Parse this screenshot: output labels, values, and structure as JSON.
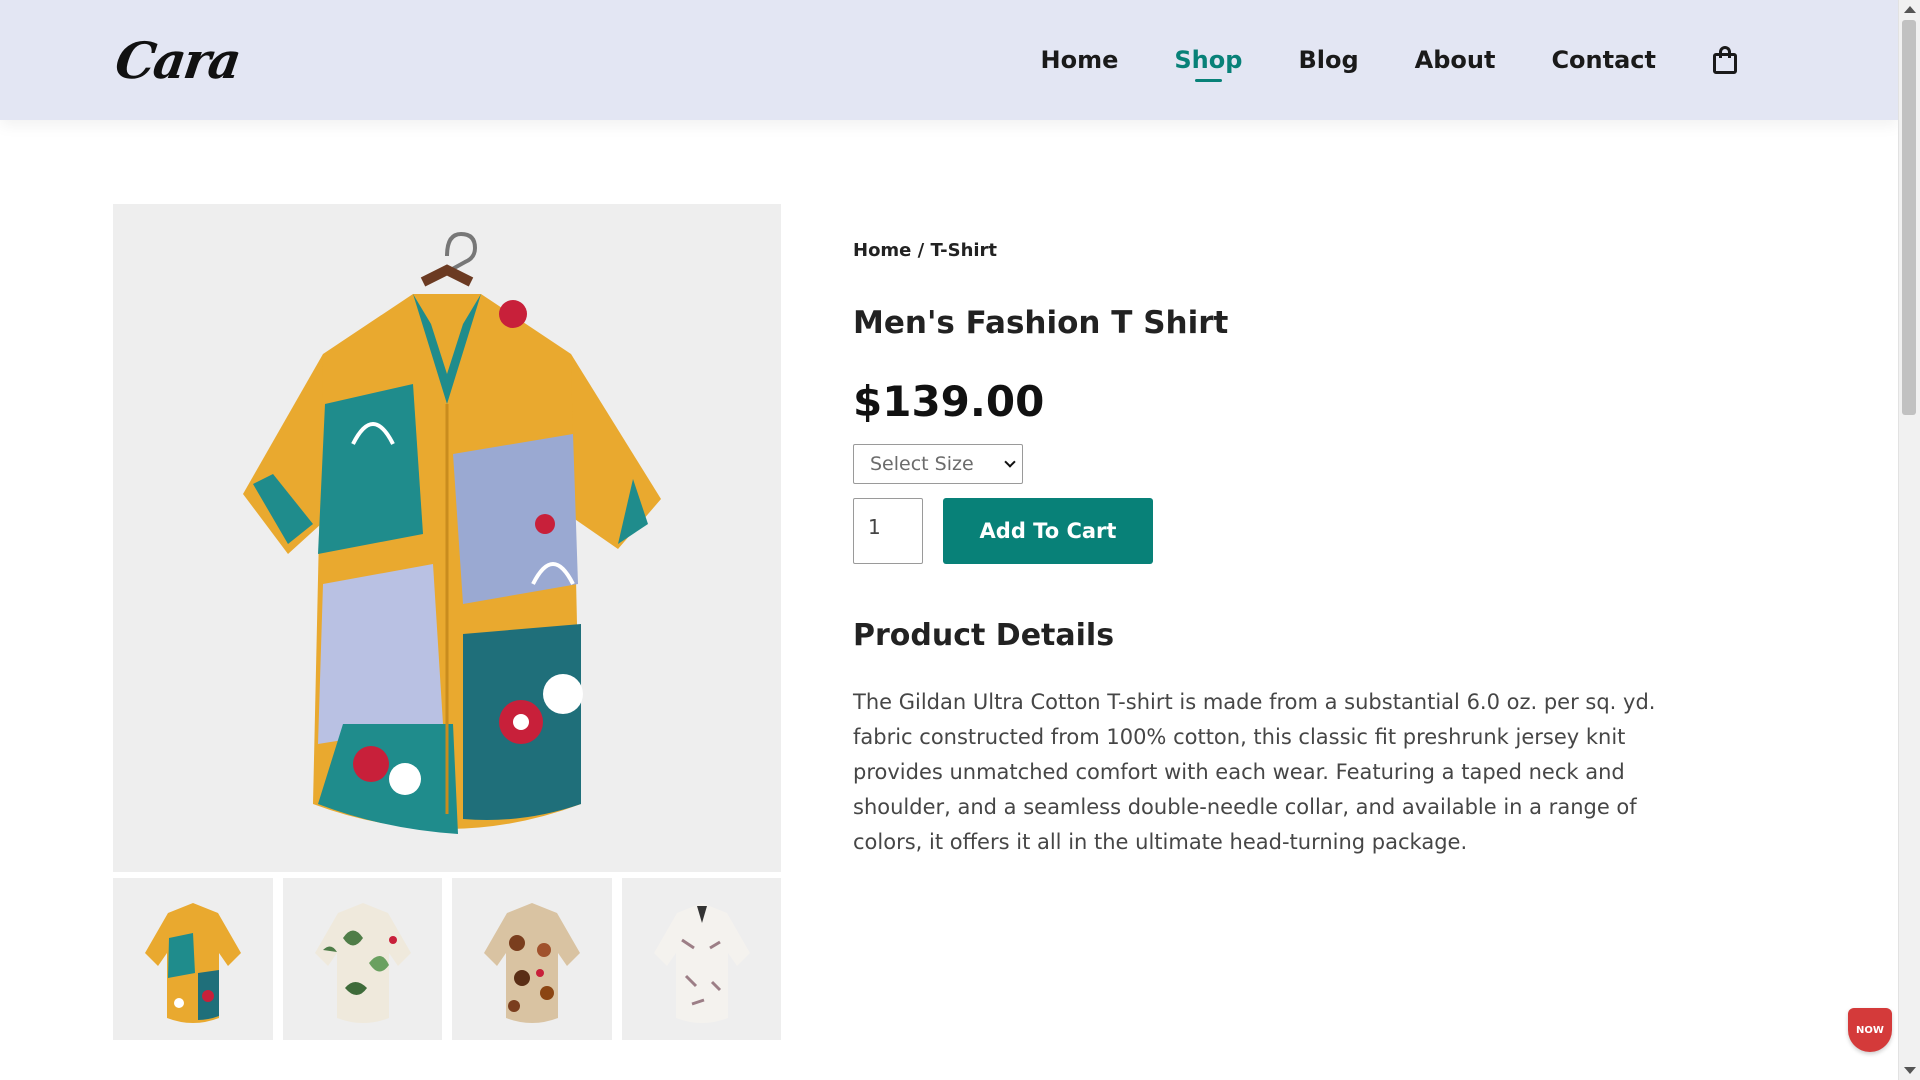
{
  "header": {
    "logo_text": "Cara",
    "nav": [
      {
        "label": "Home"
      },
      {
        "label": "Shop"
      },
      {
        "label": "Blog"
      },
      {
        "label": "About"
      },
      {
        "label": "Contact"
      }
    ],
    "active_nav": "Shop",
    "cart_icon": "shopping-bag-icon"
  },
  "product": {
    "breadcrumb": "Home / T-Shirt",
    "title": "Men's Fashion T Shirt",
    "price": "$139.00",
    "size_select": {
      "selected": "Select Size",
      "icon": "chevron-down-icon"
    },
    "quantity": "1",
    "add_to_cart_label": "Add To Cart",
    "details_heading": "Product Details",
    "description": "The Gildan Ultra Cotton T-shirt is made from a substantial 6.0 oz. per sq. yd. fabric constructed from 100% cotton, this classic fit preshrunk jersey knit provides unmatched comfort with each wear. Featuring a taped neck and shoulder, and a seamless double-needle collar, and available in a range of colors, it offers it all in the ultimate head-turning package.",
    "main_image": "patterned-shirt-teal-yellow",
    "thumbnails": [
      "patterned-shirt-teal-yellow",
      "shirt-white-green-leaf",
      "shirt-brown-floral",
      "shirt-white-print"
    ]
  },
  "badge": {
    "text": "NOW"
  },
  "colors": {
    "accent": "#088178",
    "header_bg": "#e3e6f3",
    "image_bg": "#eeeeee"
  }
}
